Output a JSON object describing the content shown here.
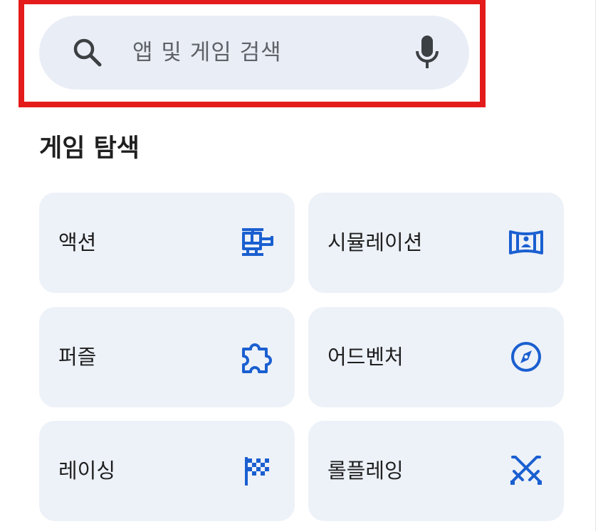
{
  "search": {
    "placeholder": "앱 및 게임 검색",
    "search_icon": "search-icon",
    "mic_icon": "microphone-icon"
  },
  "section": {
    "title": "게임 탐색"
  },
  "categories": [
    {
      "label": "액션",
      "icon": "helicopter-icon"
    },
    {
      "label": "시뮬레이션",
      "icon": "panorama-person-icon"
    },
    {
      "label": "퍼즐",
      "icon": "puzzle-piece-icon"
    },
    {
      "label": "어드벤처",
      "icon": "compass-icon"
    },
    {
      "label": "레이싱",
      "icon": "checkered-flag-icon"
    },
    {
      "label": "롤플레잉",
      "icon": "crossed-swords-icon"
    }
  ],
  "colors": {
    "highlight": "#e31b1b",
    "search_bg": "#e9edf6",
    "card_bg": "#edf1f8",
    "icon_blue": "#1a5fd0",
    "text_dark": "#1f1f1f",
    "text_muted": "#5f6368"
  }
}
